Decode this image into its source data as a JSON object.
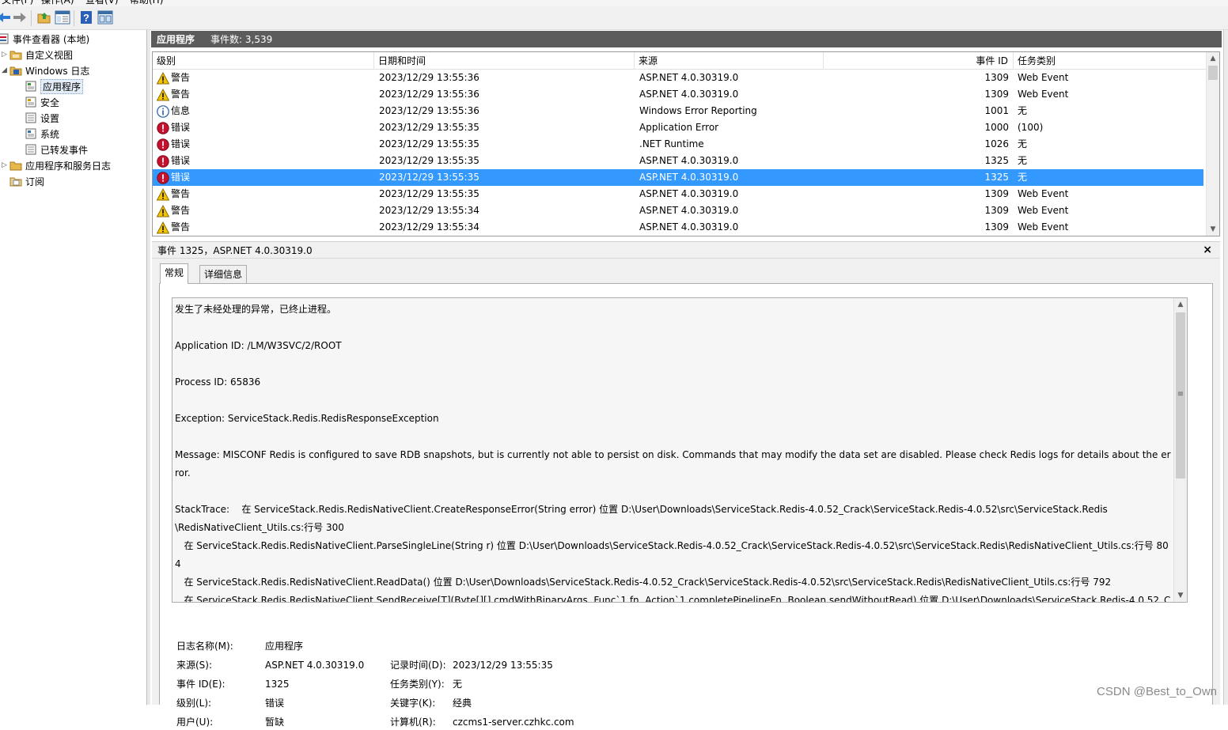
{
  "menubar": {
    "items": [
      "文件(F)",
      "操作(A)",
      "查看(V)",
      "帮助(H)"
    ]
  },
  "toolbar": {
    "buttons": [
      "back-icon",
      "forward-icon",
      "folder-up-icon",
      "properties-icon",
      "help-icon",
      "console-icon"
    ]
  },
  "tree": {
    "items": [
      {
        "label": "事件查看器 (本地)",
        "icon": "event-viewer-icon"
      },
      {
        "label": "自定义视图",
        "icon": "folder-icon"
      },
      {
        "label": "Windows 日志",
        "icon": "windows-logs-icon"
      },
      {
        "label": "应用程序",
        "icon": "log-icon"
      },
      {
        "label": "安全",
        "icon": "log-icon"
      },
      {
        "label": "设置",
        "icon": "log-icon"
      },
      {
        "label": "系统",
        "icon": "log-icon"
      },
      {
        "label": "已转发事件",
        "icon": "log-icon"
      },
      {
        "label": "应用程序和服务日志",
        "icon": "folder-icon"
      },
      {
        "label": "订阅",
        "icon": "subscription-icon"
      }
    ]
  },
  "header": {
    "title": "应用程序",
    "count": "事件数: 3,539"
  },
  "list": {
    "columns": [
      "级别",
      "日期和时间",
      "来源",
      "事件 ID",
      "任务类别"
    ],
    "rows": [
      {
        "level": "警告",
        "type": "warning",
        "datetime": "2023/12/29 13:55:36",
        "source": "ASP.NET 4.0.30319.0",
        "id": "1309",
        "task": "Web Event"
      },
      {
        "level": "警告",
        "type": "warning",
        "datetime": "2023/12/29 13:55:36",
        "source": "ASP.NET 4.0.30319.0",
        "id": "1309",
        "task": "Web Event"
      },
      {
        "level": "信息",
        "type": "info",
        "datetime": "2023/12/29 13:55:36",
        "source": "Windows Error Reporting",
        "id": "1001",
        "task": "无"
      },
      {
        "level": "错误",
        "type": "error",
        "datetime": "2023/12/29 13:55:35",
        "source": "Application Error",
        "id": "1000",
        "task": "(100)"
      },
      {
        "level": "错误",
        "type": "error",
        "datetime": "2023/12/29 13:55:35",
        "source": ".NET Runtime",
        "id": "1026",
        "task": "无"
      },
      {
        "level": "错误",
        "type": "error",
        "datetime": "2023/12/29 13:55:35",
        "source": "ASP.NET 4.0.30319.0",
        "id": "1325",
        "task": "无"
      },
      {
        "level": "错误",
        "type": "error",
        "datetime": "2023/12/29 13:55:35",
        "source": "ASP.NET 4.0.30319.0",
        "id": "1325",
        "task": "无",
        "selected": true
      },
      {
        "level": "警告",
        "type": "warning",
        "datetime": "2023/12/29 13:55:35",
        "source": "ASP.NET 4.0.30319.0",
        "id": "1309",
        "task": "Web Event"
      },
      {
        "level": "警告",
        "type": "warning",
        "datetime": "2023/12/29 13:55:34",
        "source": "ASP.NET 4.0.30319.0",
        "id": "1309",
        "task": "Web Event"
      },
      {
        "level": "警告",
        "type": "warning",
        "datetime": "2023/12/29 13:55:34",
        "source": "ASP.NET 4.0.30319.0",
        "id": "1309",
        "task": "Web Event"
      }
    ]
  },
  "detail": {
    "title": "事件 1325，ASP.NET 4.0.30319.0",
    "close": "×",
    "tabs": [
      "常规",
      "详细信息"
    ],
    "description": "发生了未经处理的异常，已终止进程。\n\nApplication ID: /LM/W3SVC/2/ROOT\n\nProcess ID: 65836\n\nException: ServiceStack.Redis.RedisResponseException\n\nMessage: MISCONF Redis is configured to save RDB snapshots, but is currently not able to persist on disk. Commands that may modify the data set are disabled. Please check Redis logs for details about the error.\n\nStackTrace:    在 ServiceStack.Redis.RedisNativeClient.CreateResponseError(String error) 位置 D:\\User\\Downloads\\ServiceStack.Redis-4.0.52_Crack\\ServiceStack.Redis-4.0.52\\src\\ServiceStack.Redis\n\\RedisNativeClient_Utils.cs:行号 300\n   在 ServiceStack.Redis.RedisNativeClient.ParseSingleLine(String r) 位置 D:\\User\\Downloads\\ServiceStack.Redis-4.0.52_Crack\\ServiceStack.Redis-4.0.52\\src\\ServiceStack.Redis\\RedisNativeClient_Utils.cs:行号 804\n   在 ServiceStack.Redis.RedisNativeClient.ReadData() 位置 D:\\User\\Downloads\\ServiceStack.Redis-4.0.52_Crack\\ServiceStack.Redis-4.0.52\\src\\ServiceStack.Redis\\RedisNativeClient_Utils.cs:行号 792\n   在 ServiceStack.Redis.RedisNativeClient.SendReceive[T](Byte[][] cmdWithBinaryArgs, Func`1 fn, Action`1 completePipelineFn, Boolean sendWithoutRead) 位置 D:\\User\\Downloads\\ServiceStack.Redis-4.0.52_Crack\n\\ServiceStack.Redis-4.0.52\\src\\ServiceStack.Redis\\RedisNativeClient_Utils.cs:行号 534\n   在 ServiceStack.Redis.RedisNativeClient.SendExpectData(Byte[][] cmdWithBinaryArgs) 位置 D:\\User\\Downloads\\ServiceStack.Redis-4.0.52_Crack\\ServiceStack.Redis-4.0.52\\src\\ServiceStack.Redis",
    "props": {
      "log_name_label": "日志名称(M):",
      "log_name": "应用程序",
      "source_label": "来源(S):",
      "source": "ASP.NET 4.0.30319.0",
      "logged_label": "记录时间(D):",
      "logged": "2023/12/29 13:55:35",
      "event_id_label": "事件 ID(E):",
      "event_id": "1325",
      "task_label": "任务类别(Y):",
      "task": "无",
      "level_label": "级别(L):",
      "level": "错误",
      "keywords_label": "关键字(K):",
      "keywords": "经典",
      "user_label": "用户(U):",
      "user": "暂缺",
      "computer_label": "计算机(R):",
      "computer": "czcms1-server.czhkc.com"
    }
  },
  "watermark": "CSDN @Best_to_Own",
  "colors": {
    "selection": "#3399ff",
    "header": "#5c5c5c",
    "warning": "#f5c400",
    "error": "#c8102e",
    "info": "#1f5fa8"
  }
}
